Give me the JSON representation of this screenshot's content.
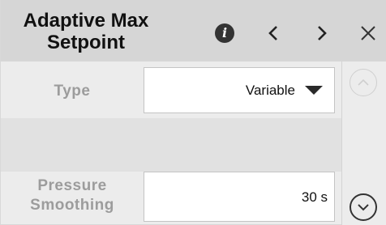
{
  "header": {
    "title_line1": "Adaptive Max",
    "title_line2": "Setpoint"
  },
  "icons": {
    "info": "info-icon",
    "prev": "chevron-left-icon",
    "next": "chevron-right-icon",
    "close": "close-icon",
    "dropdown": "caret-down-icon",
    "scroll_up": "chevron-up-circle-icon",
    "scroll_down": "chevron-down-circle-icon"
  },
  "fields": {
    "type": {
      "label": "Type",
      "value": "Variable"
    },
    "pressure_smoothing": {
      "label_line1": "Pressure",
      "label_line2": "Smoothing",
      "value": "30 s"
    }
  },
  "colors": {
    "header_bg": "#d6d6d6",
    "panel_bg": "#ececec",
    "label_text": "#9c9c9c"
  }
}
